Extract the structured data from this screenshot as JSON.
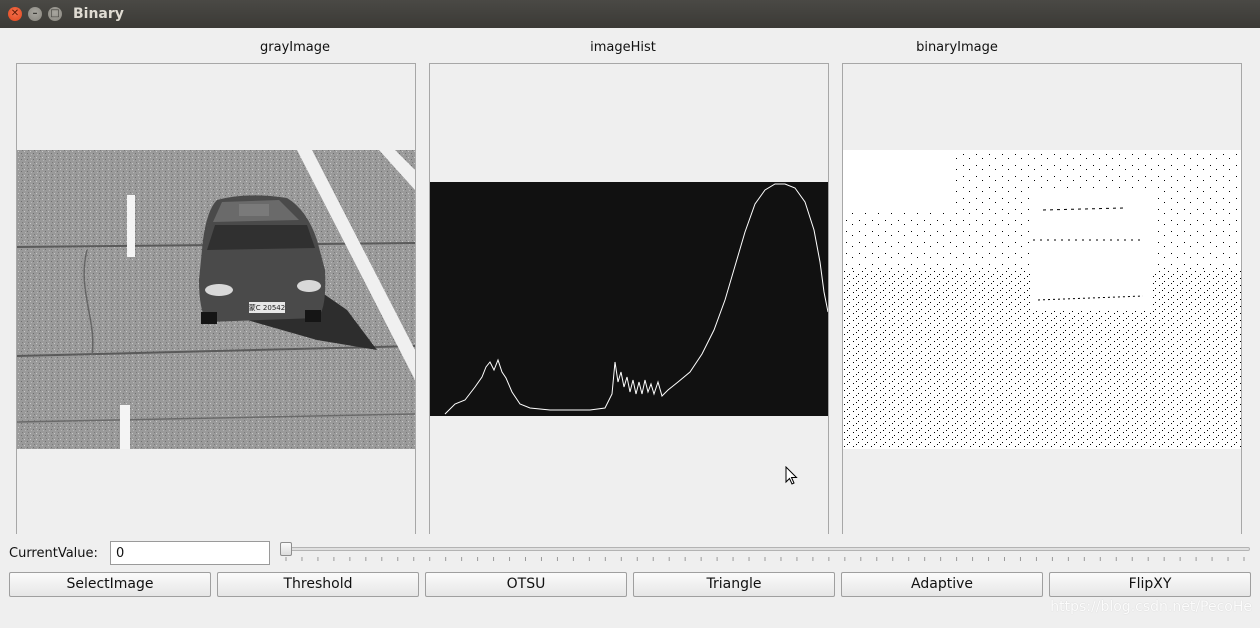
{
  "window": {
    "title": "Binary"
  },
  "panels": {
    "gray": {
      "title": "grayImage"
    },
    "hist": {
      "title": "imageHist"
    },
    "binary": {
      "title": "binaryImage"
    }
  },
  "plate_text": "蒙C 20542",
  "controls": {
    "current_label": "CurrentValue:",
    "current_value": "0",
    "slider_value": 0
  },
  "buttons": [
    "SelectImage",
    "Threshold",
    "OTSU",
    "Triangle",
    "Adaptive",
    "FlipXY"
  ],
  "watermark": "https://blog.csdn.net/PecoHe",
  "colors": {
    "titlebar": "#3c3b37",
    "close": "#e9541f",
    "hist_bg": "#111111"
  }
}
